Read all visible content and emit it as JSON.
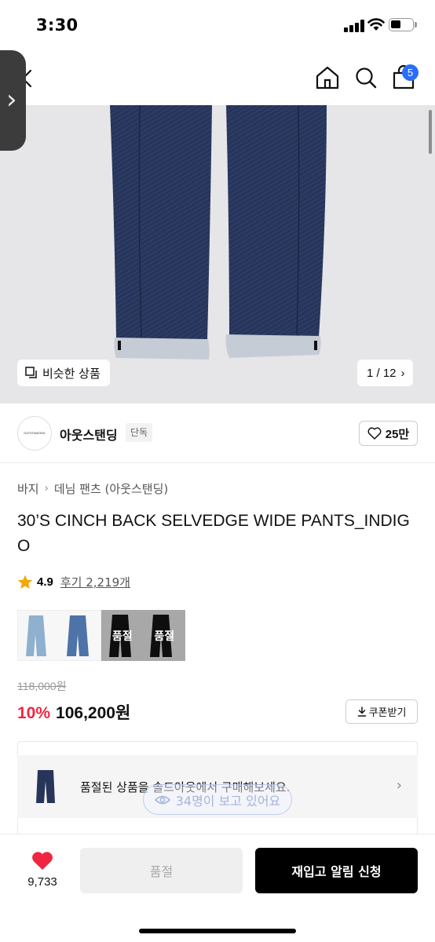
{
  "status_bar": {
    "time": "3:30"
  },
  "nav": {
    "cart_count": "5",
    "icons": [
      "chevron-left-icon",
      "home-icon",
      "search-icon",
      "shopping-bag-icon"
    ]
  },
  "gallery": {
    "similar_label": "비슷한 상품",
    "page_indicator": "1 / 12"
  },
  "brand": {
    "name": "아웃스탠딩",
    "badge": "단독",
    "logo_text": "OUTSTANDING",
    "likes": "25만"
  },
  "breadcrumb": [
    "바지",
    "데님 팬츠 (아웃스탠딩)"
  ],
  "product": {
    "title": "30’S CINCH BACK SELVEDGE WIDE PANTS_INDIGO",
    "rating": "4.9",
    "reviews": "후기 2,219개",
    "original_price": "118,000원",
    "discount": "10%",
    "sale_price": "106,200원",
    "coupon_label": "쿠폰받기"
  },
  "color_options": [
    {
      "name": "light-wash",
      "color": "#8fb0cf",
      "sold_out": false,
      "label": ""
    },
    {
      "name": "black",
      "color": "#0e0e0e",
      "sold_out": true,
      "label": "품절"
    }
  ],
  "notice": {
    "soldout_text": "품절된 상품을 솔드아웃에서 구매해보세요.",
    "viewers": "34명이 보고 있어요"
  },
  "bottom_bar": {
    "wish_count": "9,733",
    "soldout_button": "품절",
    "restock_button": "재입고 알림 신청"
  },
  "colors": {
    "accent_red": "#f0263f",
    "badge_blue": "#2a6ef5",
    "denim": "#27355a"
  }
}
